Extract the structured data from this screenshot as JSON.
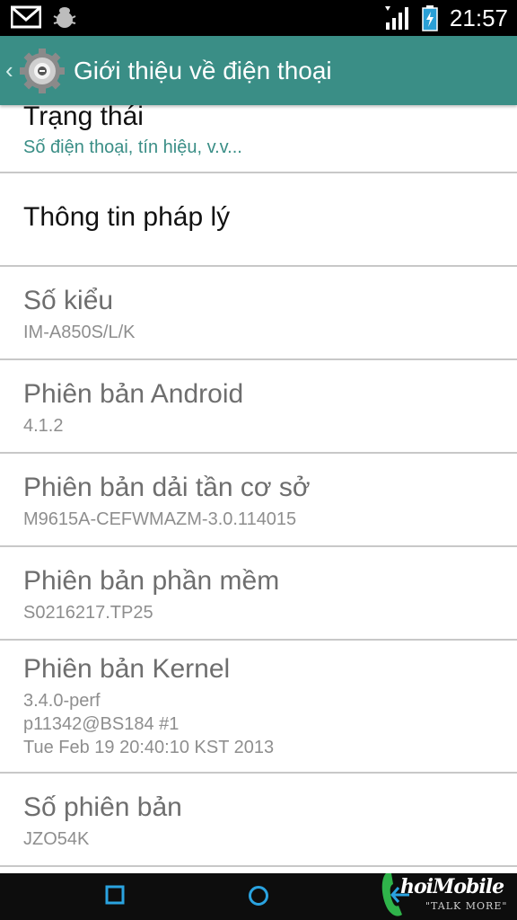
{
  "status_bar": {
    "time": "21:57",
    "left_icons": [
      "gmail-icon",
      "bug-icon"
    ],
    "right_icons": [
      "signal-icon",
      "battery-icon"
    ]
  },
  "action_bar": {
    "title": "Giới thiệu về điện thoại",
    "icon": "settings-gear-icon"
  },
  "items": [
    {
      "title": "Trạng thái",
      "sub": [
        "Số điện thoại, tín hiệu, v.v..."
      ],
      "enabled": true
    },
    {
      "title": "Thông tin pháp lý",
      "sub": [],
      "enabled": true
    },
    {
      "title": "Số kiểu",
      "sub": [
        "IM-A850S/L/K"
      ],
      "enabled": false
    },
    {
      "title": "Phiên bản Android",
      "sub": [
        "4.1.2"
      ],
      "enabled": false
    },
    {
      "title": "Phiên bản dải tần cơ sở",
      "sub": [
        "M9615A-CEFWMAZM-3.0.114015"
      ],
      "enabled": false
    },
    {
      "title": "Phiên bản phần mềm",
      "sub": [
        "S0216217.TP25"
      ],
      "enabled": false
    },
    {
      "title": "Phiên bản Kernel",
      "sub": [
        "3.4.0-perf",
        "p11342@BS184 #1",
        "Tue Feb 19 20:40:10 KST 2013"
      ],
      "enabled": false
    },
    {
      "title": "Số phiên bản",
      "sub": [
        "JZO54K"
      ],
      "enabled": false
    }
  ],
  "nav_bar": {
    "buttons": [
      "recent-apps-icon",
      "home-icon",
      "back-icon"
    ]
  },
  "watermark": {
    "text": "hoiMobile",
    "tagline": "\"TALK MORE\""
  },
  "colors": {
    "accent": "#3a8e86",
    "divider": "#c8c8c8"
  }
}
